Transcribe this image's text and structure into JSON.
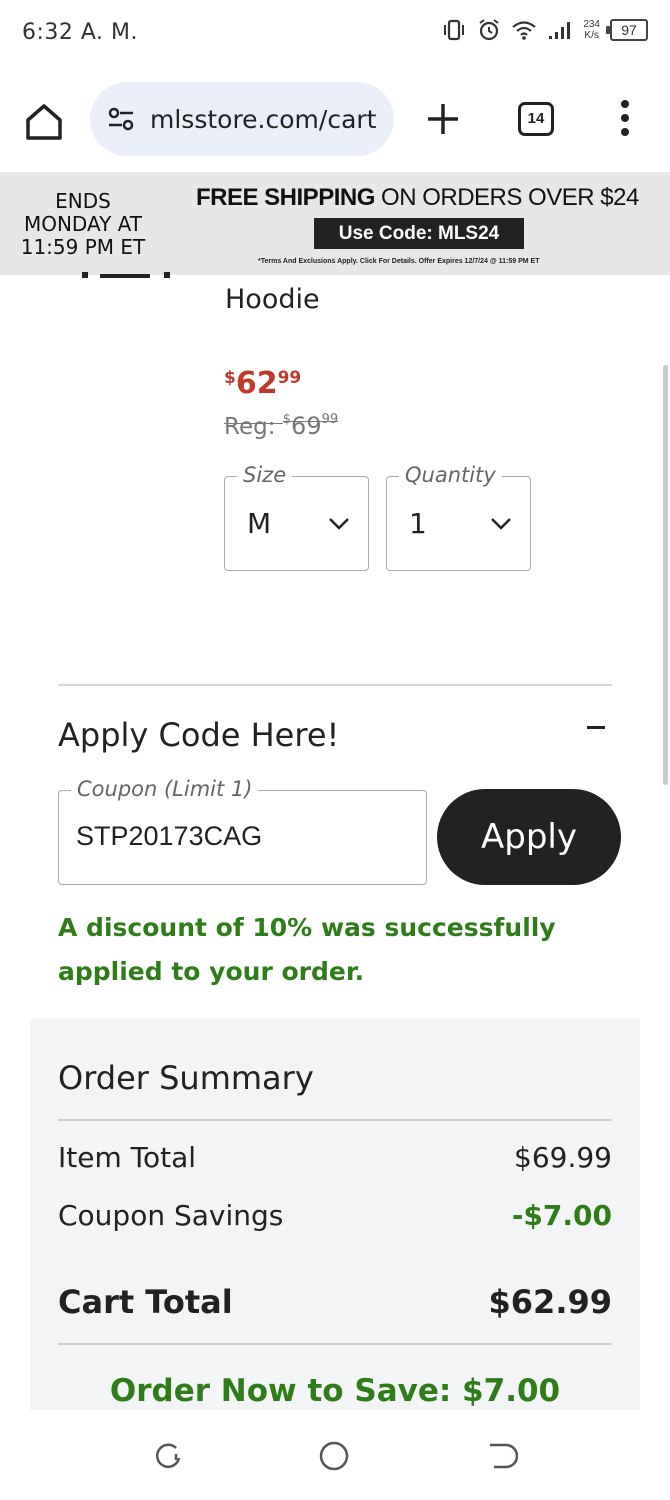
{
  "status_bar": {
    "time": "6:32 A. M.",
    "speed_value": "234",
    "speed_unit": "K/s",
    "battery": "97"
  },
  "browser": {
    "url": "mlsstore.com/cart",
    "tab_count": "14"
  },
  "promo": {
    "ends_text": "ENDS MONDAY AT 11:59 PM ET",
    "headline_bold": "FREE SHIPPING",
    "headline_rest": " ON ORDERS OVER $24",
    "code_text": "Use Code: MLS24",
    "terms": "*Terms And Exclusions Apply. Click For Details. Offer Expires 12/7/24 @ 11:59 PM ET"
  },
  "product": {
    "name": "Hoodie",
    "sale_currency": "$",
    "sale_dollars": "62",
    "sale_cents": "99",
    "reg_label": "Reg: ",
    "reg_currency": "$",
    "reg_dollars": "69",
    "reg_cents": "99",
    "size_label": "Size",
    "size_value": "M",
    "quantity_label": "Quantity",
    "quantity_value": "1"
  },
  "coupon": {
    "title": "Apply Code Here!",
    "collapse_symbol": "−",
    "field_label": "Coupon (Limit 1)",
    "field_value": "STP20173CAG",
    "apply_label": "Apply",
    "success_message": "A discount of 10% was successfully applied to your order."
  },
  "summary": {
    "title": "Order Summary",
    "item_total_label": "Item Total",
    "item_total_value": "$69.99",
    "coupon_savings_label": "Coupon Savings",
    "coupon_savings_value": "-$7.00",
    "cart_total_label": "Cart Total",
    "cart_total_value": "$62.99",
    "save_message": "Order Now to Save: $7.00"
  },
  "colors": {
    "sale_red": "#c0392b",
    "success_green": "#2e7d19",
    "dark_button": "#222222",
    "url_pill": "#e9eef8",
    "promo_bg": "#e7e7e7",
    "summary_bg": "#f3f4f6"
  },
  "icons": {
    "home": "home-icon",
    "site_settings": "tune-icon",
    "new_tab": "plus-icon",
    "menu": "more-vert-icon",
    "chevron": "chevron-down-icon",
    "nav_recents": "recents-icon",
    "nav_home": "nav-home-icon",
    "nav_back": "back-icon"
  }
}
